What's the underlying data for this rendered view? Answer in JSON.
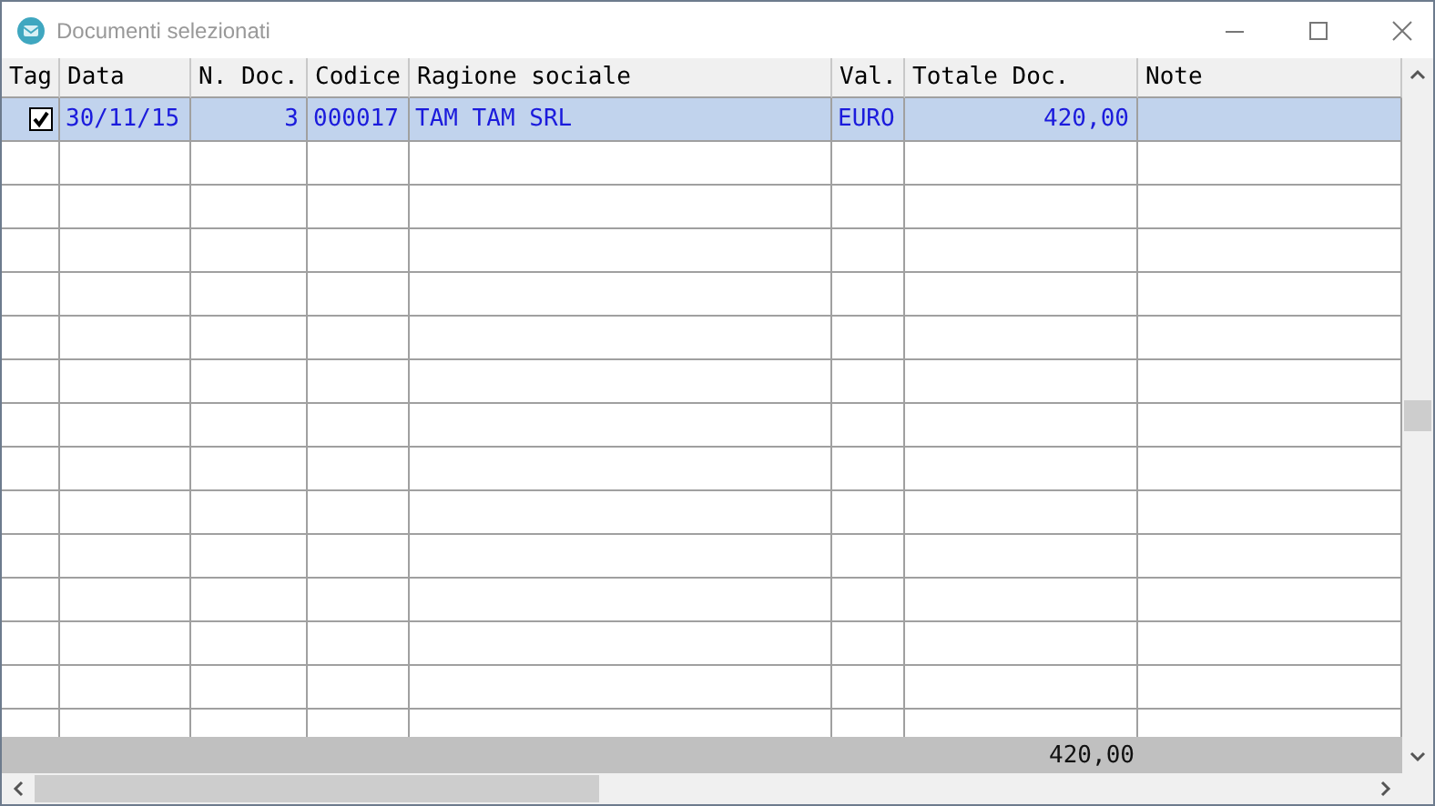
{
  "window": {
    "title": "Documenti selezionati"
  },
  "table": {
    "columns": [
      "Tag",
      "Data",
      "N. Doc.",
      "Codice",
      "Ragione sociale",
      "Val.",
      "Totale Doc.",
      "Note"
    ],
    "rows": [
      {
        "tag": {
          "checked": true
        },
        "selected": true,
        "cells": [
          "",
          "30/11/15",
          "3",
          "000017",
          "TAM TAM SRL",
          "EURO",
          "420,00",
          ""
        ]
      }
    ],
    "footer_total": "420,00"
  }
}
